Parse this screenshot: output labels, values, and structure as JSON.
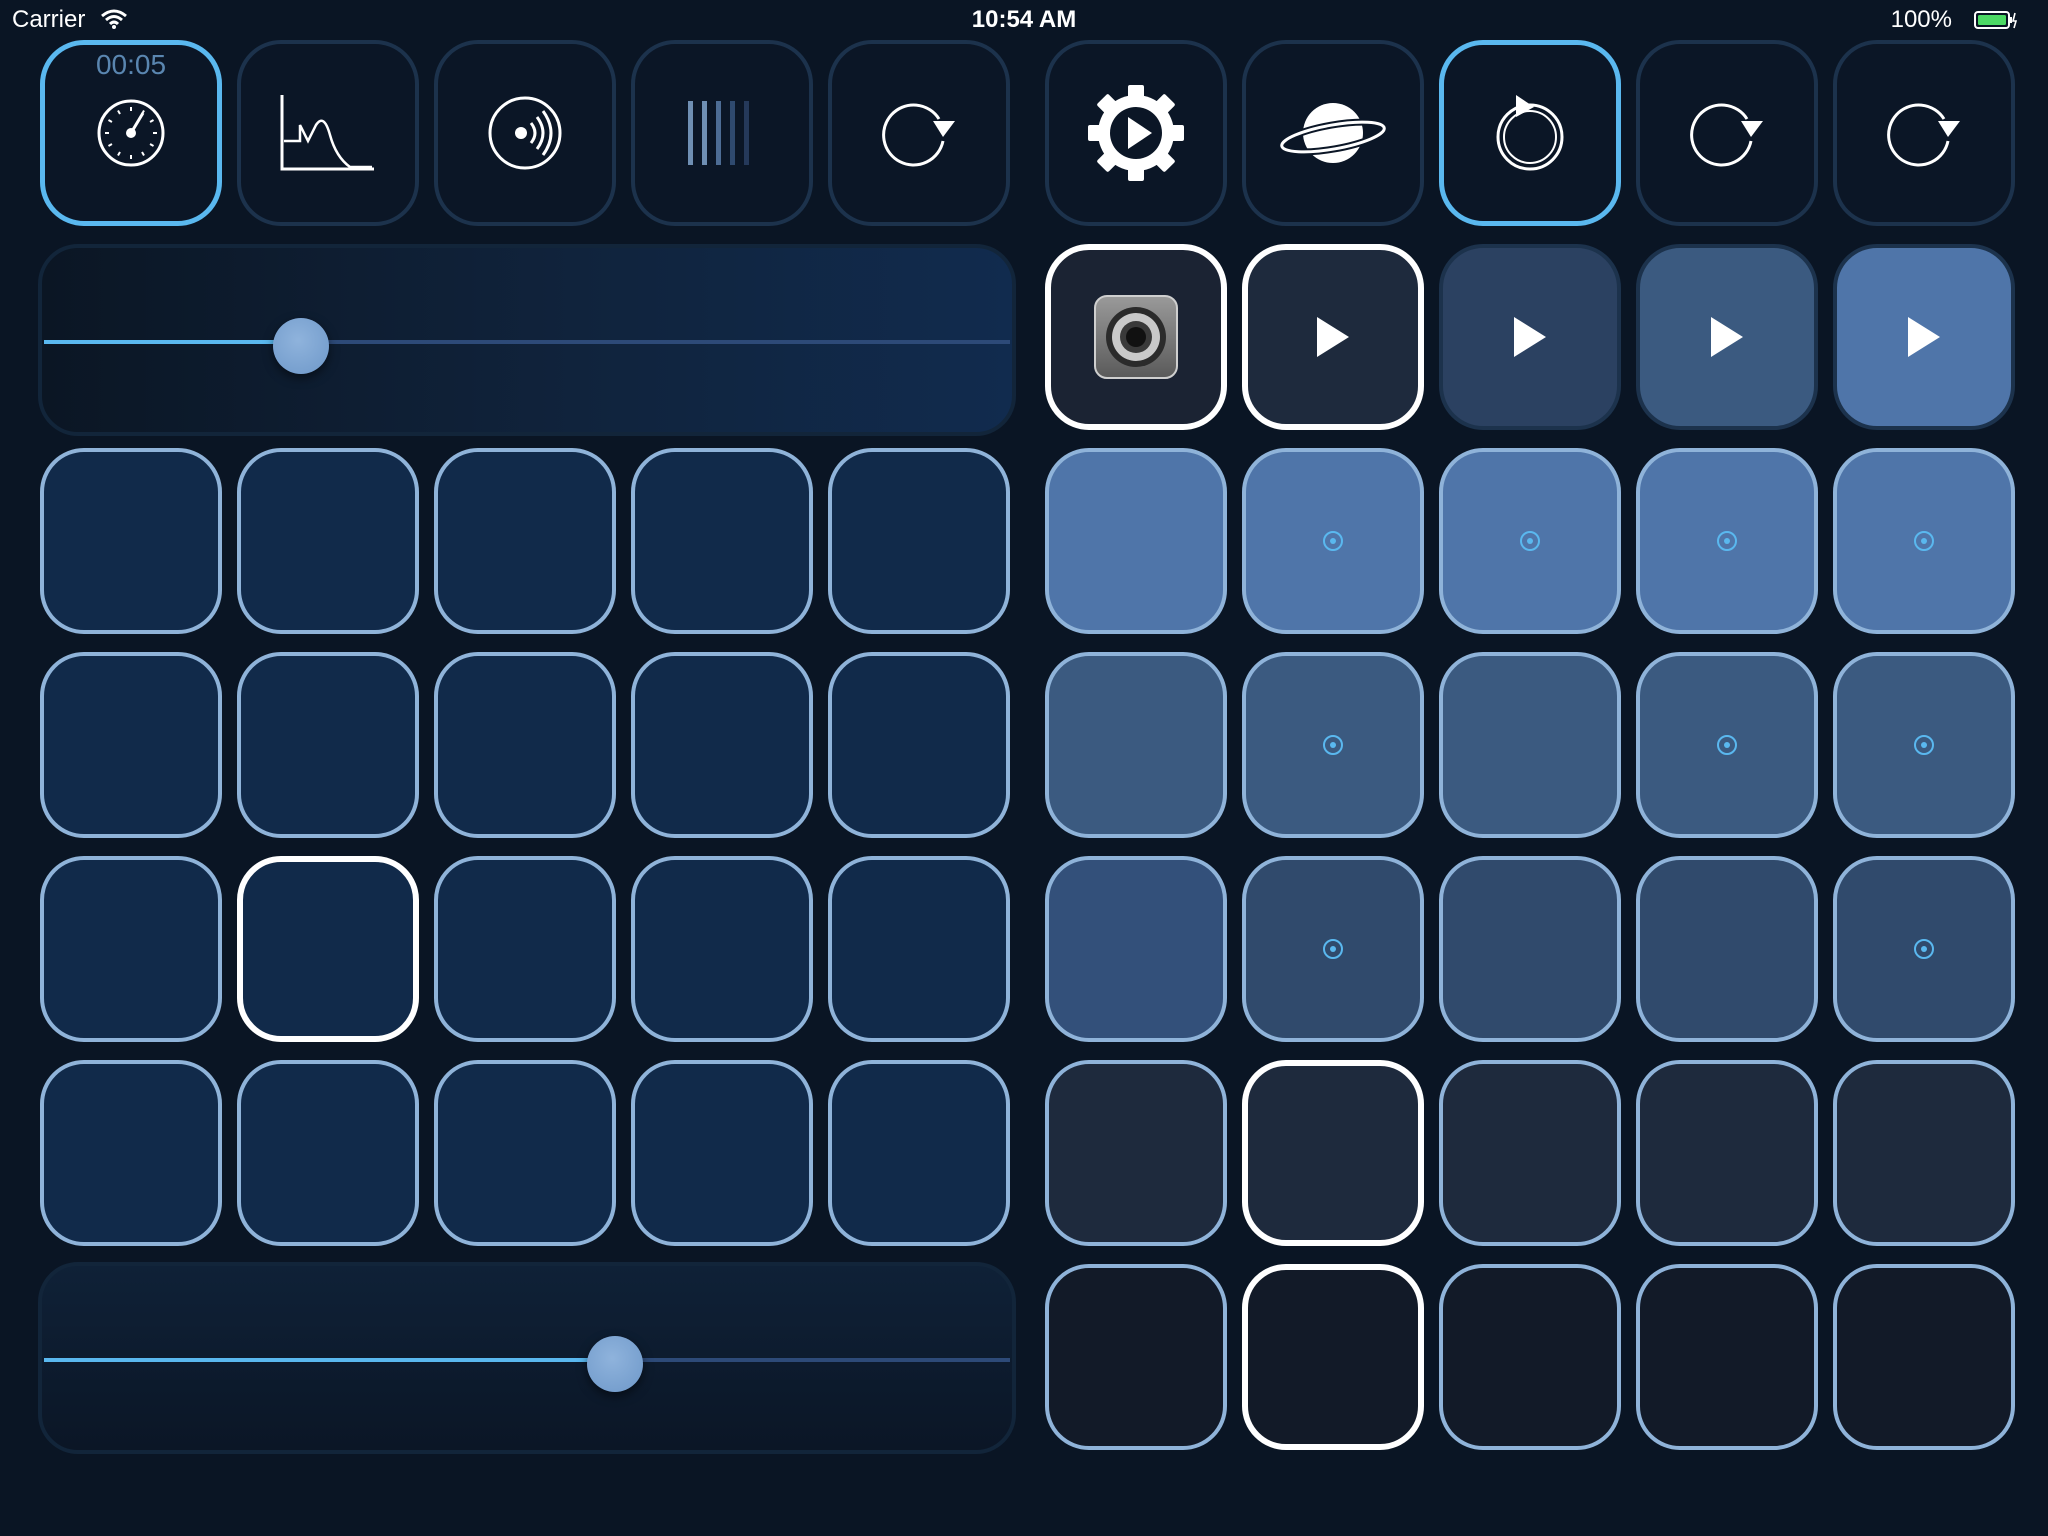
{
  "status_bar": {
    "carrier": "Carrier",
    "time": "10:54 AM",
    "battery": "100%"
  },
  "toolbar": {
    "timer": "00:05",
    "left_tools": [
      {
        "icon": "tempo-dial-icon",
        "active": true
      },
      {
        "icon": "envelope-curve-icon",
        "active": false
      },
      {
        "icon": "sound-wave-icon",
        "active": false
      },
      {
        "icon": "level-bars-icon",
        "active": false
      },
      {
        "icon": "loop-arrow-icon",
        "active": false
      }
    ],
    "right_tools": [
      {
        "icon": "play-settings-gear-icon",
        "active": false
      },
      {
        "icon": "planet-icon",
        "active": false
      },
      {
        "icon": "loop-record-icon",
        "active": true
      },
      {
        "icon": "loop-arrow-icon",
        "active": false
      },
      {
        "icon": "loop-arrow-icon",
        "active": false
      }
    ]
  },
  "sliders": [
    {
      "name": "top-slider",
      "value": 0.266
    },
    {
      "name": "bottom-slider",
      "value": 0.591
    }
  ],
  "colors": {
    "background": "#0a1524",
    "accent": "#5ab8ef",
    "pad_border": "#8fb3d9",
    "left_pad": "#112a4a",
    "row1": "#4f75a9",
    "row2": "#3b5a80",
    "row3": "#304a6c",
    "row4": "#1e2a3d",
    "row5": "#121a28"
  },
  "clip_launchers": [
    {
      "kind": "speaker-icon",
      "fill": "#1b2333",
      "selected": true
    },
    {
      "kind": "play-icon",
      "fill": "#1e2a3d",
      "selected": true
    },
    {
      "kind": "play-icon",
      "fill": "#2b4161",
      "selected": false
    },
    {
      "kind": "play-icon",
      "fill": "#3b5a80",
      "selected": false
    },
    {
      "kind": "play-icon",
      "fill": "#4f75a9",
      "selected": false
    }
  ],
  "left_grid": {
    "rows": 4,
    "cols": 5,
    "selected": [
      [
        2,
        1
      ]
    ]
  },
  "right_grid": {
    "row_fills": [
      "#4f75a9",
      "#3b5a80",
      "#304a6c",
      "#1e2a3d",
      "#121a28"
    ],
    "first_col_fills": [
      "#4f75a9",
      "#3b5a80",
      "#33507a",
      "#1e2a3d",
      "#121a28"
    ],
    "dots": [
      [
        false,
        true,
        true,
        true,
        true
      ],
      [
        false,
        true,
        false,
        true,
        true
      ],
      [
        false,
        true,
        false,
        false,
        true
      ],
      [
        false,
        false,
        false,
        false,
        false
      ],
      [
        false,
        false,
        false,
        false,
        false
      ]
    ],
    "selected": [
      [
        3,
        1
      ],
      [
        4,
        1
      ]
    ]
  }
}
